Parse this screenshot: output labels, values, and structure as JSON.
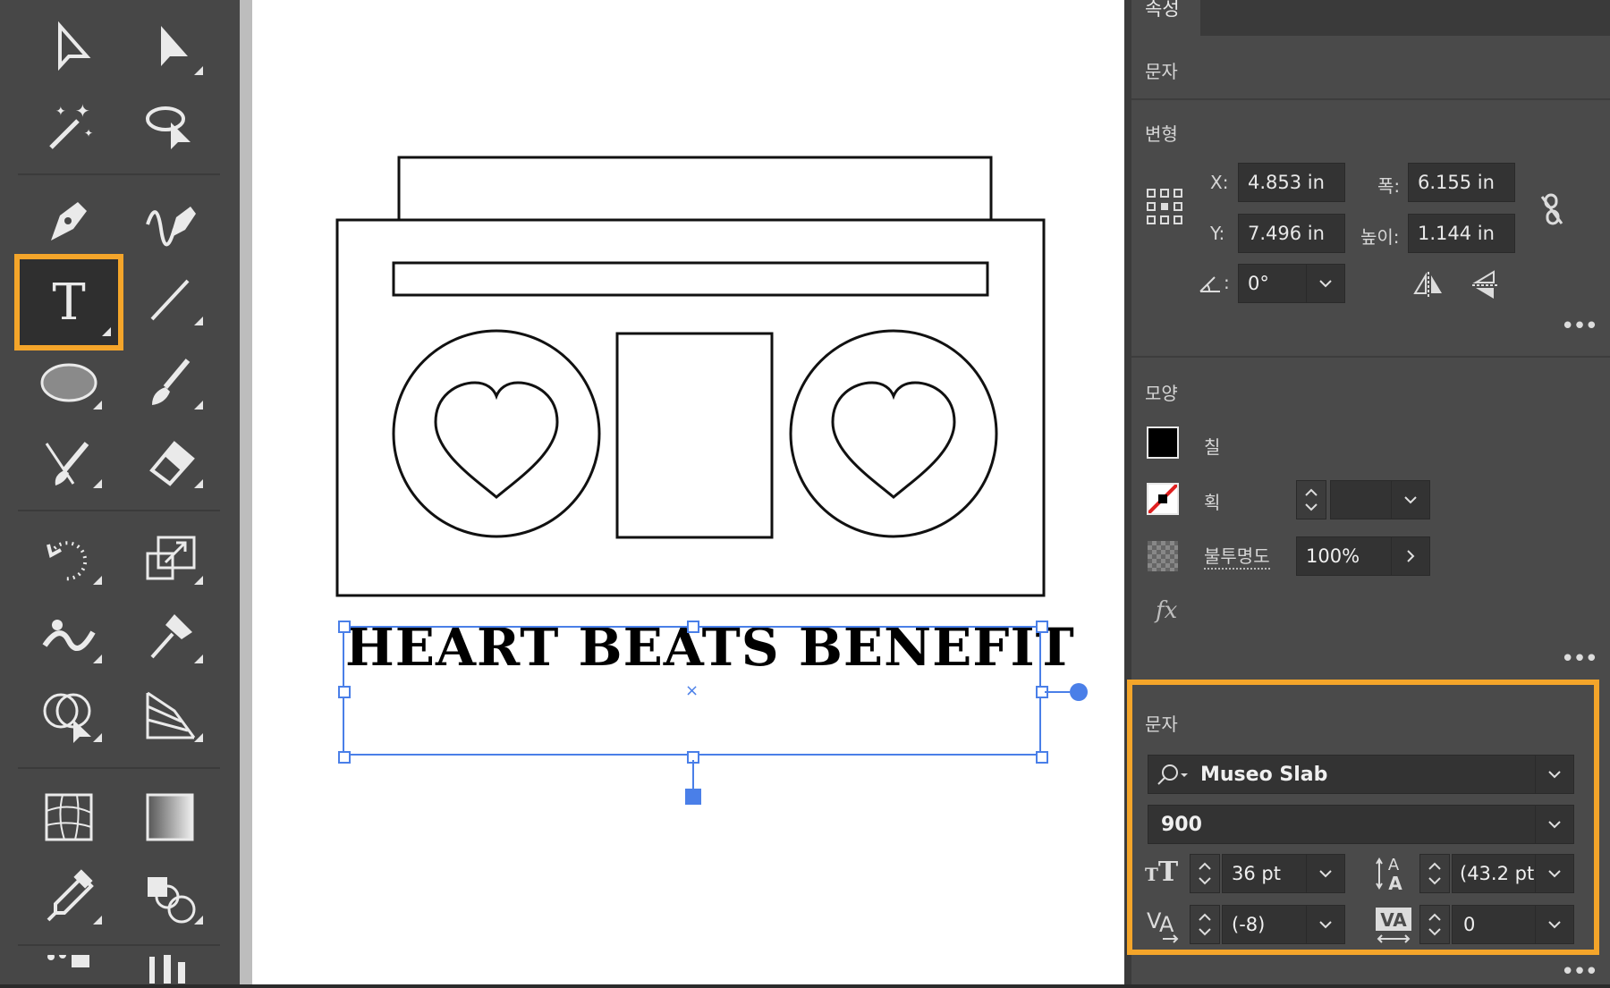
{
  "panel": {
    "tab_title": "속성",
    "section_doc": "문자",
    "transform": {
      "title": "변형",
      "x_label": "X:",
      "x_value": "4.853 in",
      "y_label": "Y:",
      "y_value": "7.496 in",
      "w_label": "폭:",
      "w_value": "6.155 in",
      "h_label": "높이:",
      "h_value": "1.144 in",
      "angle_label": ":",
      "angle_value": "0°"
    },
    "appearance": {
      "title": "모양",
      "fill_label": "칠",
      "stroke_label": "획",
      "opacity_label": "불투명도",
      "opacity_value": "100%",
      "fx_label": "fx"
    },
    "character": {
      "title": "문자",
      "font_family": "Museo Slab",
      "font_style": "900",
      "font_size": "36 pt",
      "leading": "(43.2 pt",
      "kerning": "(-8)",
      "tracking": "0"
    }
  },
  "canvas": {
    "headline": "HEART BEATS BENEFIT"
  },
  "colors": {
    "highlight": "#f4a52a",
    "selection": "#4a7fe8"
  }
}
